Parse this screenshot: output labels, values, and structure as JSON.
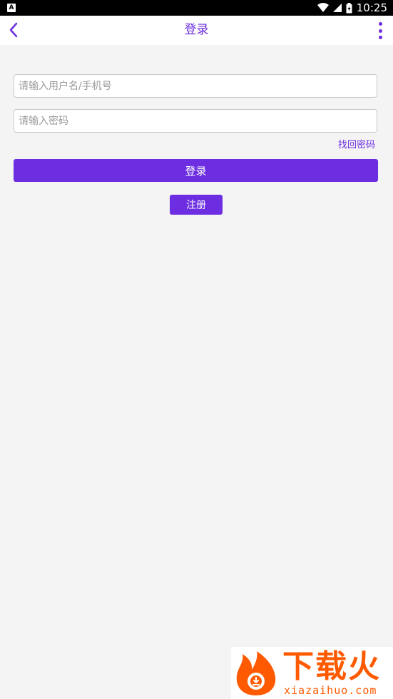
{
  "status_bar": {
    "left_badge": "A",
    "time": "10:25",
    "icons": [
      "wifi-icon",
      "signal-icon",
      "battery-icon"
    ]
  },
  "header": {
    "title": "登录",
    "back_icon": "chevron-left-icon",
    "more_icon": "more-vertical-icon"
  },
  "form": {
    "username": {
      "value": "",
      "placeholder": "请输入用户名/手机号"
    },
    "password": {
      "value": "",
      "placeholder": "请输入密码"
    },
    "forgot_label": "找回密码",
    "login_label": "登录",
    "register_label": "注册"
  },
  "watermark": {
    "text": "下载火",
    "sub": "xiazaihuo.com"
  },
  "colors": {
    "accent": "#6c2ee0",
    "background": "#f4f4f4",
    "watermark": "#ff5a00"
  }
}
